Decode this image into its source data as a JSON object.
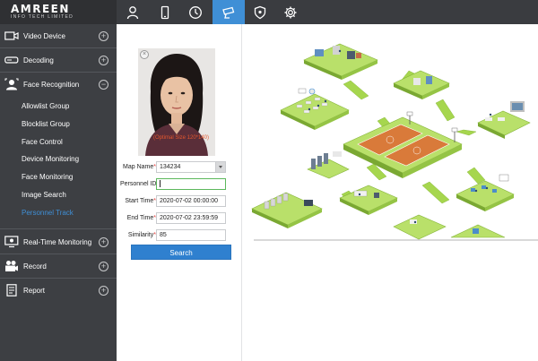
{
  "brand": {
    "name": "AMREEN",
    "tagline": "INFO TECH LIMITED"
  },
  "topnav": [
    {
      "icon": "user-icon",
      "active": false
    },
    {
      "icon": "phone-icon",
      "active": false
    },
    {
      "icon": "clock-icon",
      "active": false
    },
    {
      "icon": "camera-icon",
      "active": true
    },
    {
      "icon": "shield-icon",
      "active": false
    },
    {
      "icon": "gear-icon",
      "active": false
    }
  ],
  "sidebar": {
    "video_device": "Video Device",
    "decoding": "Decoding",
    "face_recognition": "Face Recognition",
    "sub_items": [
      "Allowlist Group",
      "Blocklist Group",
      "Face Control",
      "Device Monitoring",
      "Face Monitoring",
      "Image Search",
      "Personnel Track"
    ],
    "real_time_monitoring": "Real-Time Monitoring",
    "record": "Record",
    "report": "Report",
    "expand_symbol": "+",
    "collapse_symbol": "−"
  },
  "form": {
    "photo_caption": "(Optimal Size 120*140)",
    "close_symbol": "×",
    "map_name_label": "Map Name",
    "map_name_value": "134234",
    "personnel_id_label": "Personnel ID",
    "personnel_id_value": "",
    "start_time_label": "Start Time",
    "start_time_value": "2020-07-02 00:00:00",
    "end_time_label": "End Time",
    "end_time_value": "2020-07-02 23:59:59",
    "similarity_label": "Similarity",
    "similarity_value": "85",
    "required_mark": "*",
    "search_button": "Search"
  },
  "colors": {
    "accent": "#3f8fd6",
    "sidebar": "#3d3f43",
    "topbar": "#3a3c40",
    "caption": "#e4572e",
    "map_green": "#8cc63f",
    "court": "#d97a3a"
  }
}
